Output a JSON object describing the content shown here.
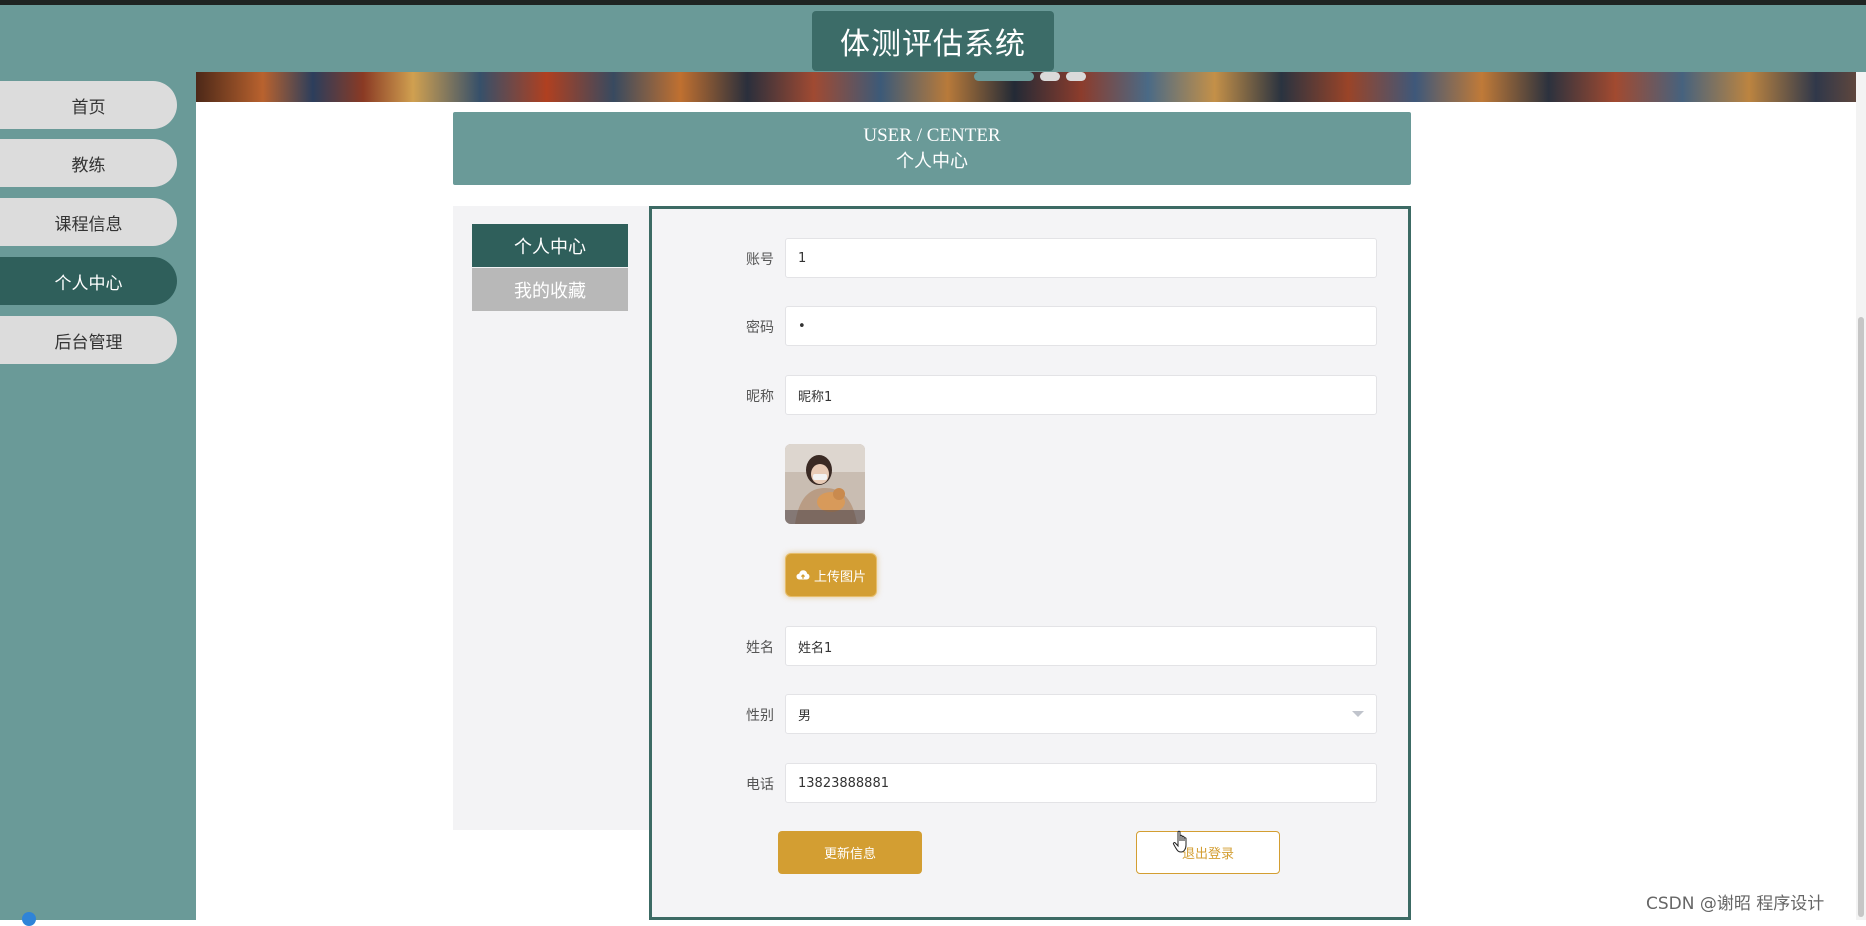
{
  "app": {
    "title": "体测评估系统"
  },
  "sidebar": {
    "items": [
      {
        "label": "首页",
        "active": false
      },
      {
        "label": "教练",
        "active": false
      },
      {
        "label": "课程信息",
        "active": false
      },
      {
        "label": "个人中心",
        "active": true
      },
      {
        "label": "后台管理",
        "active": false
      }
    ]
  },
  "section": {
    "title_en": "USER / CENTER",
    "title_cn": "个人中心"
  },
  "tabs": [
    {
      "label": "个人中心",
      "active": true
    },
    {
      "label": "我的收藏",
      "active": false
    }
  ],
  "form": {
    "account": {
      "label": "账号",
      "value": "1"
    },
    "password": {
      "label": "密码",
      "value": "•"
    },
    "nickname": {
      "label": "昵称",
      "value": "昵称1"
    },
    "upload_label": "上传图片",
    "name": {
      "label": "姓名",
      "value": "姓名1"
    },
    "gender": {
      "label": "性别",
      "value": "男"
    },
    "phone": {
      "label": "电话",
      "value": "13823888881"
    }
  },
  "actions": {
    "update_label": "更新信息",
    "logout_label": "退出登录"
  },
  "watermark": "CSDN @谢昭  程序设计",
  "colors": {
    "theme": "#6a9a98",
    "theme_dark": "#2f5f5b",
    "accent": "#d39e32"
  }
}
